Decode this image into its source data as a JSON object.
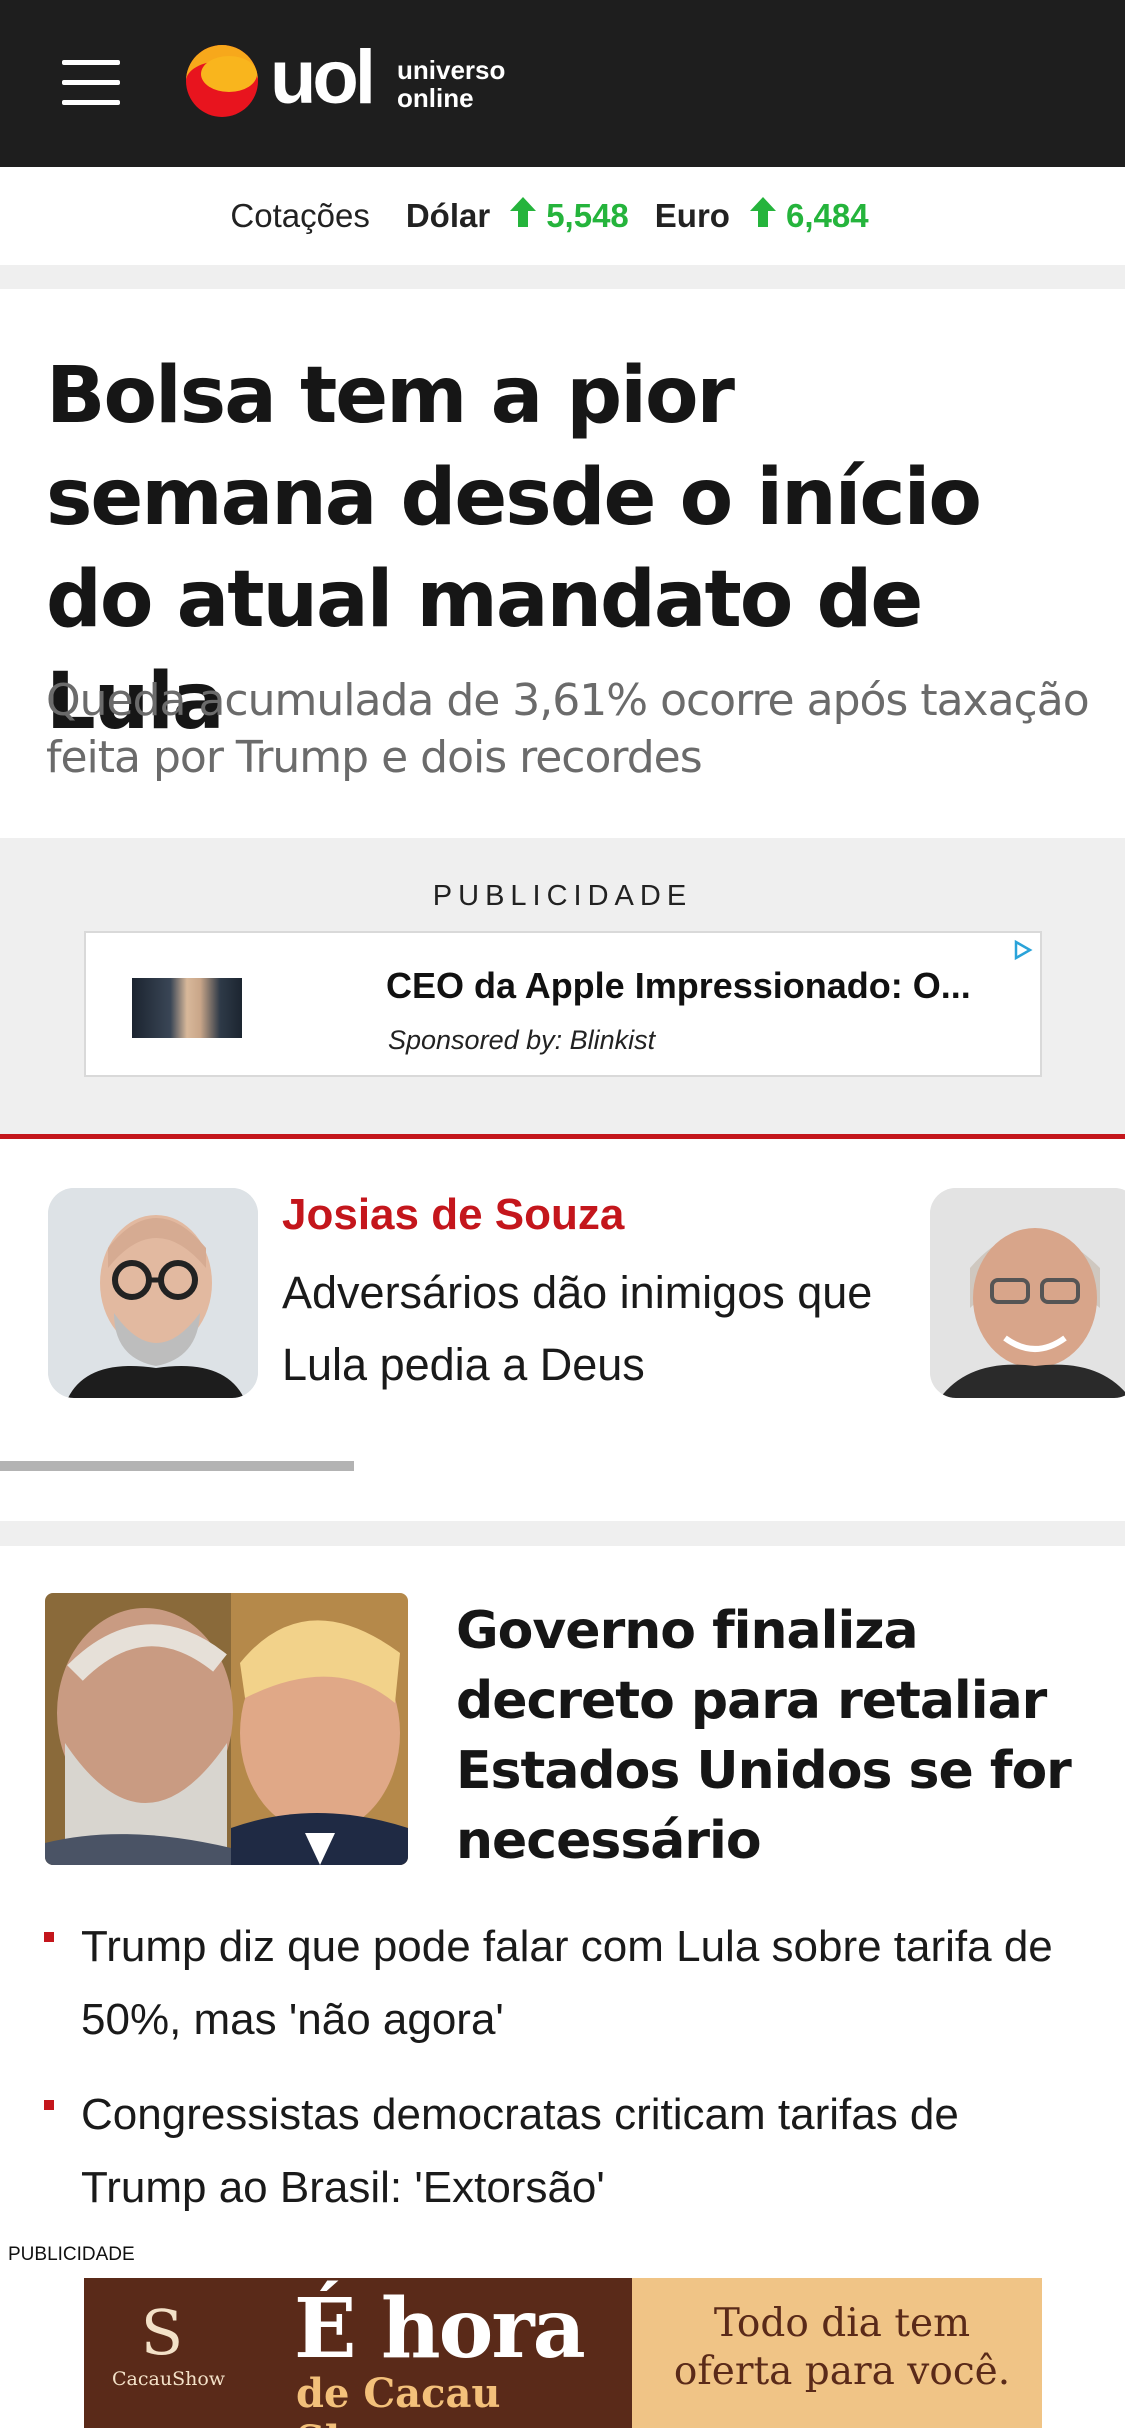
{
  "header": {
    "logo_word": "uol",
    "logo_sub_line1": "universo",
    "logo_sub_line2": "online",
    "menu_icon": "hamburger-menu-icon",
    "background": "#1e1e1e"
  },
  "quotes": {
    "label": "Cotações",
    "items": [
      {
        "currency": "Dólar",
        "direction_icon": "arrow-up-icon",
        "value": "5,548"
      },
      {
        "currency": "Euro",
        "direction_icon": "arrow-up-icon",
        "value": "6,484"
      }
    ],
    "up_color": "#25b43c"
  },
  "lead": {
    "headline": "Bolsa tem a pior semana desde o início do atual mandato de Lula",
    "subhead": "Queda acumulada de 3,61% ocorre após taxação feita por Trump e dois recordes"
  },
  "ad": {
    "label": "PUBLICIDADE",
    "title": "CEO da Apple Impressionado: O...",
    "sponsor": "Sponsored by: Blinkist",
    "choice_icon": "adchoices-icon"
  },
  "columnist": {
    "author": "Josias de Souza",
    "title": "Adversários dão inimigos que Lula pedia a Deus",
    "accent": "#c4161c"
  },
  "story": {
    "title": "Governo finaliza decreto para retaliar Estados Unidos se for necessário",
    "related": [
      "Trump diz que pode falar com Lula sobre tarifa de 50%, mas 'não agora'",
      "Congressistas democratas criticam tarifas de Trump ao Brasil: 'Extorsão'"
    ]
  },
  "sticky_ad": {
    "label": "PUBLICIDADE",
    "brand": "CacauShow",
    "headline_line1": "É hora",
    "headline_line2": "de Cacau Show",
    "offer": "Todo dia tem oferta para você."
  }
}
